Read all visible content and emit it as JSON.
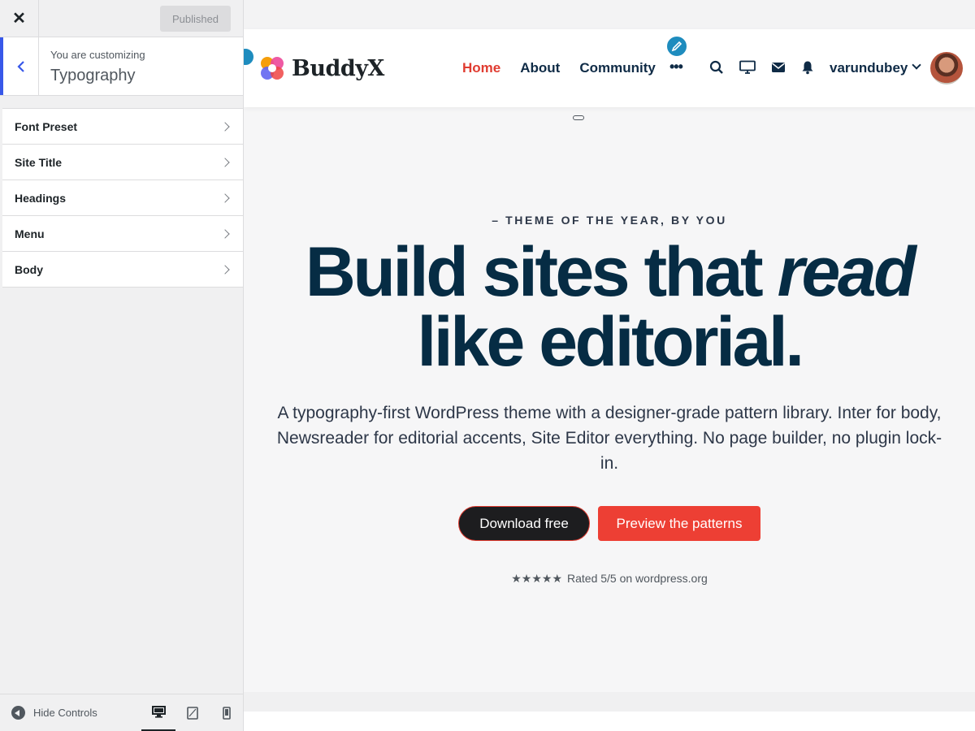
{
  "customizer": {
    "close_icon": "close-icon",
    "publish_label": "Published",
    "customizing_label": "You are customizing",
    "section_title": "Typography",
    "menu_items": [
      {
        "label": "Font Preset"
      },
      {
        "label": "Site Title"
      },
      {
        "label": "Headings"
      },
      {
        "label": "Menu"
      },
      {
        "label": "Body"
      }
    ],
    "footer": {
      "hide_label": "Hide Controls",
      "devices": [
        "desktop-icon",
        "tablet-icon",
        "mobile-icon"
      ],
      "active_device": "desktop"
    },
    "accent_color": "#3858e9"
  },
  "site": {
    "logo_text": "BuddyX",
    "nav": [
      {
        "label": "Home",
        "active": true
      },
      {
        "label": "About",
        "active": false
      },
      {
        "label": "Community",
        "active": false
      }
    ],
    "nav_more": "•••",
    "header_icons": [
      "search-icon",
      "monitor-icon",
      "mail-icon",
      "bell-icon"
    ],
    "username": "varundubey",
    "accent_color": "#e03c31",
    "hero": {
      "eyebrow": "– THEME OF THE YEAR, BY YOU",
      "headline_part1": "Build sites that",
      "headline_italic": "read",
      "headline_part2": "like editorial.",
      "description": "A typography-first WordPress theme with a designer-grade pattern library. Inter for body, Newsreader for editorial accents, Site Editor everything. No page builder, no plugin lock-in.",
      "primary_button": "Download free",
      "secondary_button": "Preview the patterns",
      "rating_stars": "★★★★★",
      "rating_text": "Rated 5/5 on wordpress.org"
    }
  }
}
